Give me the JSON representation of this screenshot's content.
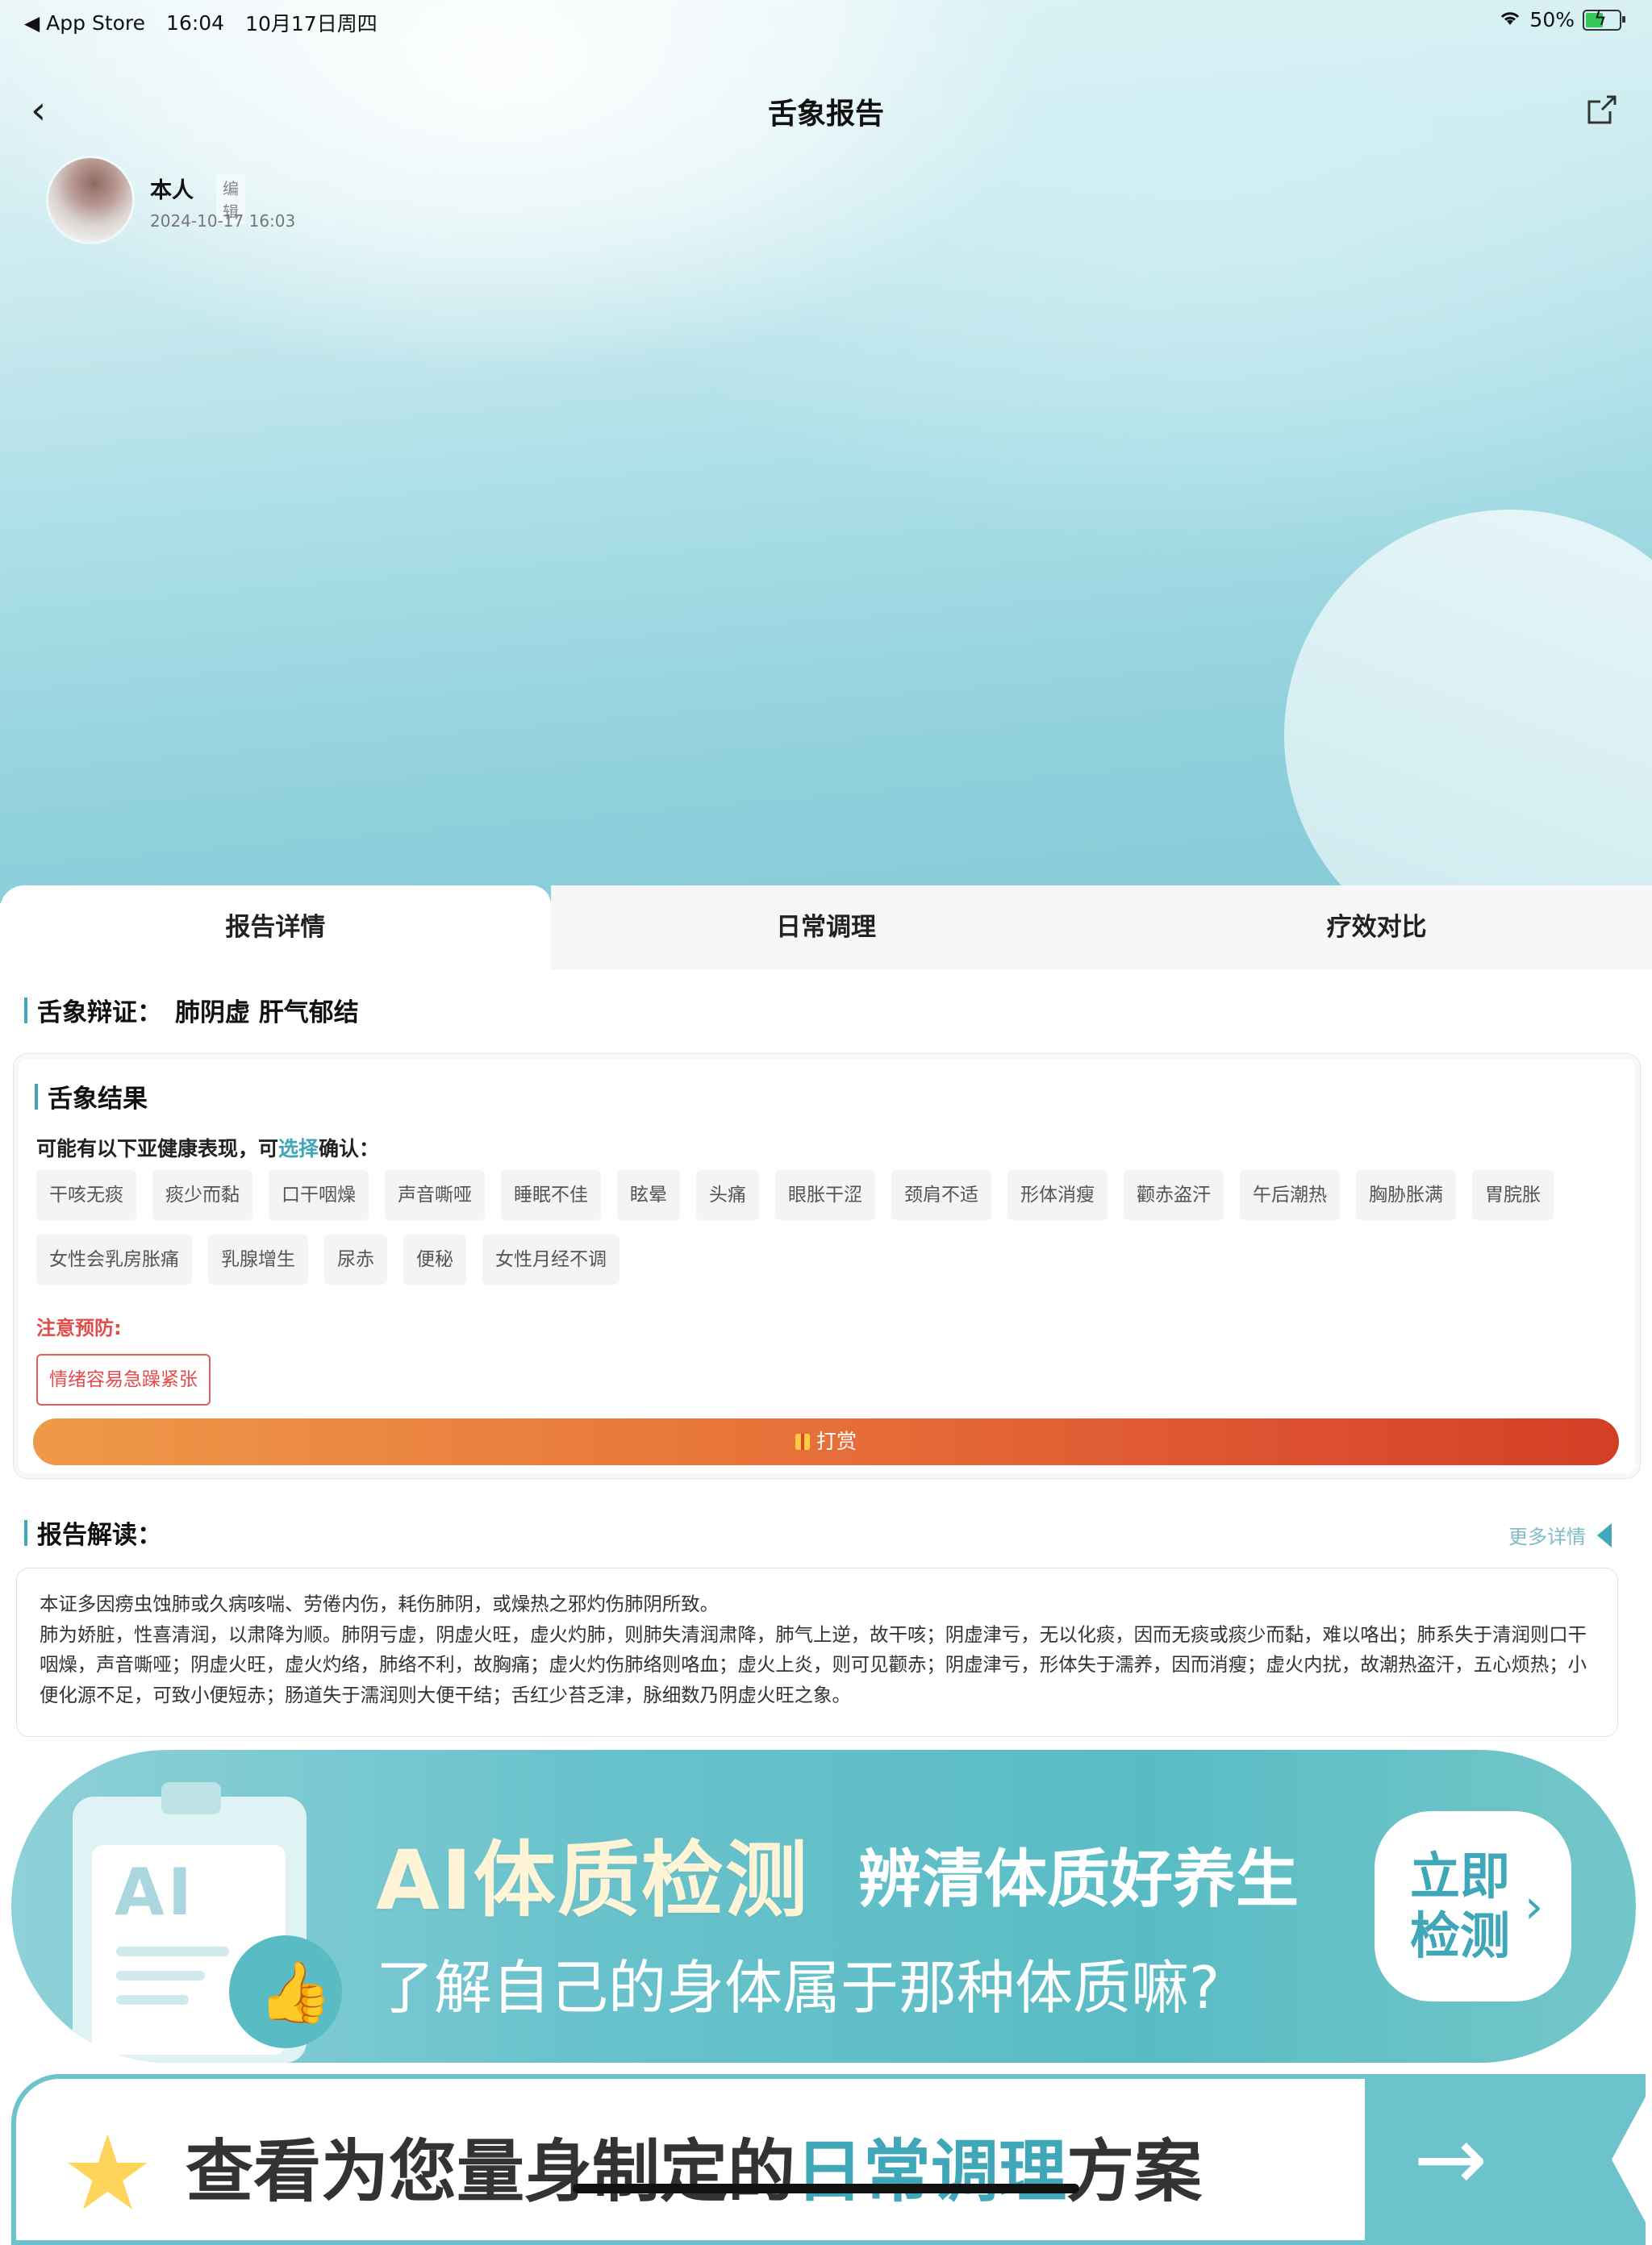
{
  "status_bar": {
    "back_app": "◀ App Store",
    "time": "16:04",
    "date": "10月17日周四",
    "battery": "50%"
  },
  "nav": {
    "title": "舌象报告"
  },
  "profile": {
    "name": "本人",
    "edit_label": "编辑",
    "datetime": "2024-10-17 16:03"
  },
  "tabs": [
    {
      "label": "报告详情",
      "active": true
    },
    {
      "label": "日常调理",
      "active": false
    },
    {
      "label": "疗效对比",
      "active": false
    }
  ],
  "diagnosis": {
    "label": "舌象辩证：",
    "value": "肺阴虚 肝气郁结"
  },
  "result": {
    "title": "舌象结果",
    "hint_prefix": "可能有以下亚健康表现，可",
    "hint_link": "选择",
    "hint_suffix": "确认：",
    "tags": [
      "干咳无痰",
      "痰少而黏",
      "口干咽燥",
      "声音嘶哑",
      "睡眠不佳",
      "眩晕",
      "头痛",
      "眼胀干涩",
      "颈肩不适",
      "形体消瘦",
      "颧赤盗汗",
      "午后潮热",
      "胸胁胀满",
      "胃脘胀",
      "女性会乳房胀痛",
      "乳腺增生",
      "尿赤",
      "便秘",
      "女性月经不调"
    ],
    "warning_label": "注意预防:",
    "warning_tag": "情绪容易急躁紧张",
    "tip_button": "打赏"
  },
  "interpretation": {
    "title": "报告解读：",
    "more_label": "更多详情",
    "paragraph1": "本证多因痨虫蚀肺或久病咳喘、劳倦内伤，耗伤肺阴，或燥热之邪灼伤肺阴所致。",
    "paragraph2": "肺为娇脏，性喜清润，以肃降为顺。肺阴亏虚，阴虚火旺，虚火灼肺，则肺失清润肃降，肺气上逆，故干咳；阴虚津亏，无以化痰，因而无痰或痰少而黏，难以咯出；肺系失于清润则口干咽燥，声音嘶哑；阴虚火旺，虚火灼络，肺络不利，故胸痛；虚火灼伤肺络则咯血；虚火上炎，则可见颧赤；阴虚津亏，形体失于濡养，因而消瘦；虚火内扰，故潮热盗汗，五心烦热；小便化源不足，可致小便短赤；肠道失于濡润则大便干结；舌红少苔乏津，脉细数乃阴虚火旺之象。"
  },
  "ai_banner": {
    "card_text": "AI",
    "title": "AI体质检测",
    "subtitle": "辨清体质好养生",
    "question": "了解自己的身体属于那种体质嘛?",
    "button_line1": "立即",
    "button_line2": "检测"
  },
  "plan_banner": {
    "text_prefix": "查看为您量身制定的",
    "text_highlight": "日常调理",
    "text_suffix": "方案"
  },
  "colors": {
    "accent": "#3fa7b8",
    "warning": "#e34b4b",
    "tip_start": "#ee9948",
    "tip_end": "#d33f25"
  }
}
